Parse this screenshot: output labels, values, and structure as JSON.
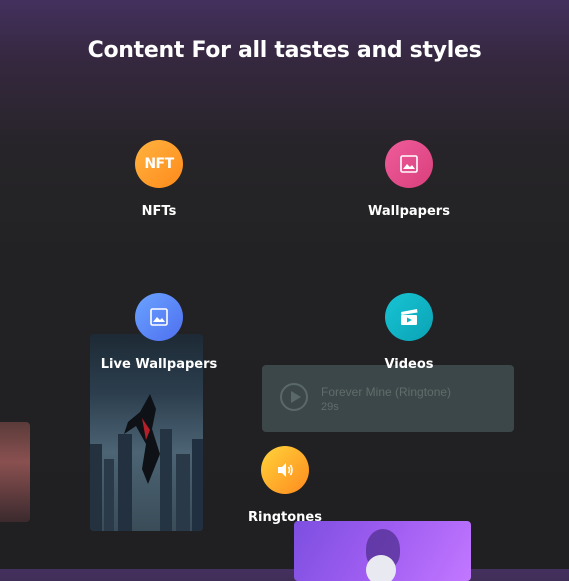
{
  "header": {
    "title": "Content For all tastes and styles"
  },
  "categories": {
    "nfts": {
      "label": "NFTs",
      "icon": "nft-icon",
      "color": "#ff9a2a",
      "icon_text": "NFT"
    },
    "wallpapers": {
      "label": "Wallpapers",
      "icon": "image-icon",
      "color": "#e64d8a"
    },
    "live_wallpapers": {
      "label": "Live Wallpapers",
      "icon": "live-image-icon",
      "color": "#5a86f7"
    },
    "videos": {
      "label": "Videos",
      "icon": "clapperboard-icon",
      "color": "#11b3c4"
    },
    "ringtones": {
      "label": "Ringtones",
      "icon": "speaker-icon",
      "color": "#ffb530"
    }
  },
  "ringtone_card": {
    "title": "Forever Mine (Ringtone)",
    "duration": "29s"
  }
}
